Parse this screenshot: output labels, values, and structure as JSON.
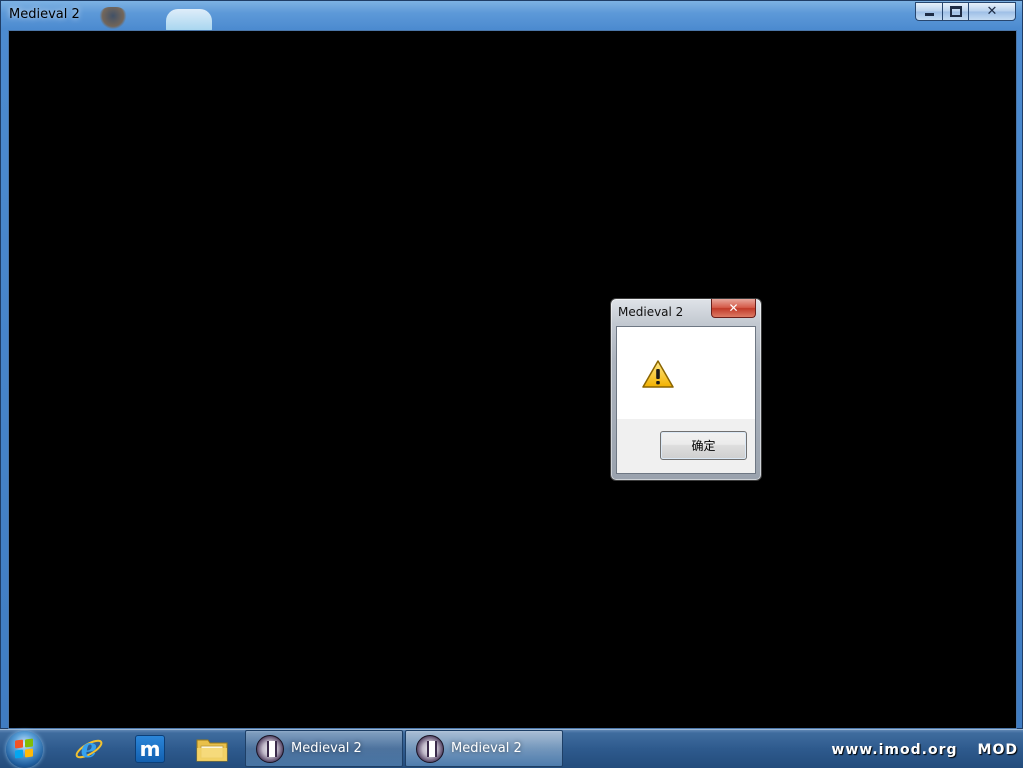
{
  "window": {
    "title": "Medieval 2",
    "controls": {
      "minimize": "minimize",
      "maximize": "maximize",
      "close": "close"
    }
  },
  "dialog": {
    "title": "Medieval 2",
    "icon": "warning-icon",
    "message": "",
    "ok_label": "确定"
  },
  "taskbar": {
    "start": "start-orb",
    "pinned": [
      {
        "name": "internet-explorer-icon"
      },
      {
        "name": "maxthon-icon",
        "glyph": "m"
      },
      {
        "name": "file-explorer-icon"
      }
    ],
    "tasks": [
      {
        "label": "Medieval 2",
        "state": "active"
      },
      {
        "label": "Medieval 2",
        "state": "inactive"
      }
    ],
    "watermark": {
      "site": "www.imod.org",
      "mod": "MOD"
    }
  },
  "colors": {
    "taskbar": "#2e5a8d",
    "titlebar": "#5d99d8",
    "client": "#000000",
    "close_button": "#c03a28"
  }
}
